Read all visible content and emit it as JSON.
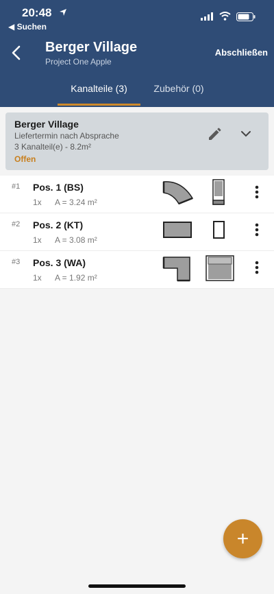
{
  "status_bar": {
    "time": "20:48",
    "back_app": "◀ Suchen"
  },
  "header": {
    "title": "Berger Village",
    "subtitle": "Project One Apple",
    "finish_label": "Abschließen"
  },
  "tabs": [
    {
      "label": "Kanalteile (3)",
      "active": true
    },
    {
      "label": "Zubehör (0)",
      "active": false
    }
  ],
  "project_card": {
    "title": "Berger Village",
    "delivery": "Liefertermin nach Absprache",
    "summary": "3 Kanalteil(e) - 8.2m²",
    "status": "Offen",
    "status_color": "#c87f1d"
  },
  "items": [
    {
      "num": "#1",
      "name": "Pos. 1 (BS)",
      "qty": "1x",
      "area": "A = 3.24 m²",
      "shape_icon": "bend-icon",
      "side_icon": "bend-side-icon"
    },
    {
      "num": "#2",
      "name": "Pos. 2 (KT)",
      "qty": "1x",
      "area": "A = 3.08 m²",
      "shape_icon": "straight-duct-icon",
      "side_icon": "rect-profile-icon"
    },
    {
      "num": "#3",
      "name": "Pos. 3 (WA)",
      "qty": "1x",
      "area": "A = 1.92 m²",
      "shape_icon": "elbow-icon",
      "side_icon": "elbow-profile-icon"
    }
  ],
  "fab_label": "+",
  "colors": {
    "header": "#2f4c76",
    "accent": "#cf8a2b",
    "card": "#d3d8dc"
  }
}
